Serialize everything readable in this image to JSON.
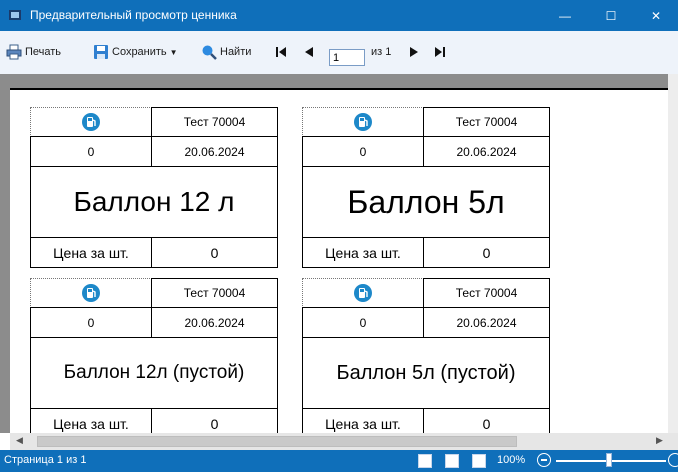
{
  "window": {
    "title": "Предварительный просмотр ценника",
    "controls": {
      "minimize": "—",
      "maximize": "☐",
      "close": "✕"
    }
  },
  "toolbar": {
    "print_label": "Печать",
    "save_label": "Сохранить",
    "find_label": "Найти",
    "page_value": "1",
    "page_total": "из 1"
  },
  "tags": [
    {
      "code": "Тест 70004",
      "qty": "0",
      "date": "20.06.2024",
      "name": "Баллон 12 л",
      "price_label": "Цена за шт.",
      "price": "0"
    },
    {
      "code": "Тест 70004",
      "qty": "0",
      "date": "20.06.2024",
      "name": "Баллон 5л",
      "price_label": "Цена за шт.",
      "price": "0"
    },
    {
      "code": "Тест 70004",
      "qty": "0",
      "date": "20.06.2024",
      "name": "Баллон 12л (пустой)",
      "price_label": "Цена за шт.",
      "price": "0"
    },
    {
      "code": "Тест 70004",
      "qty": "0",
      "date": "20.06.2024",
      "name": "Баллон 5л (пустой)",
      "price_label": "Цена за шт.",
      "price": "0"
    }
  ],
  "statusbar": {
    "page_text": "Страница 1 из 1",
    "zoom": "100%"
  },
  "colors": {
    "titlebar": "#0f6fba",
    "toolbar": "#eef3fa",
    "viewer_bg": "#8c8c8c",
    "icon_blue": "#1d88c9"
  }
}
